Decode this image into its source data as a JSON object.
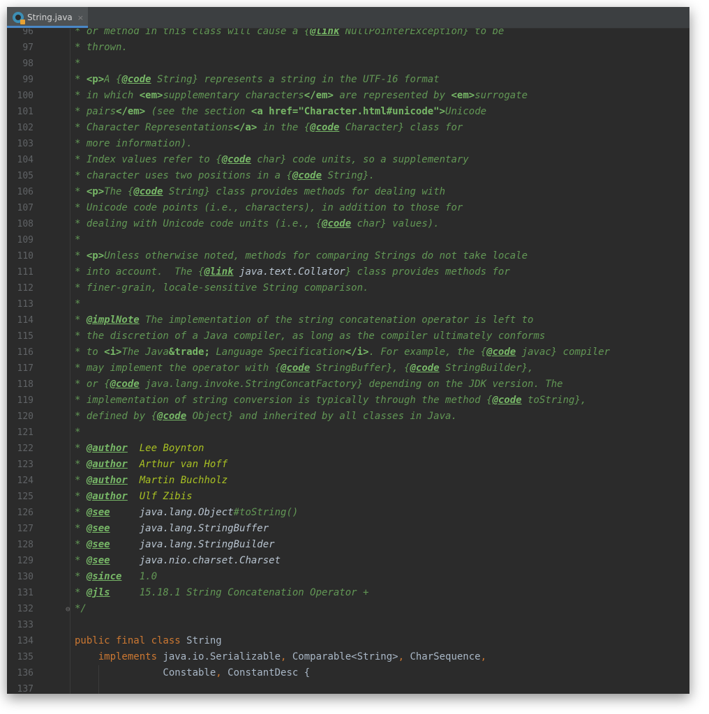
{
  "tab": {
    "label": "String.java",
    "close": "×",
    "icon": "java-class-icon"
  },
  "lines": [
    {
      "n": "96",
      "segs": [
        [
          "c",
          "* or method in this class will cause a {"
        ],
        [
          "tk",
          "@link"
        ],
        [
          "c",
          " NullPointerException} to be"
        ]
      ]
    },
    {
      "n": "97",
      "segs": [
        [
          "c",
          "* thrown."
        ]
      ]
    },
    {
      "n": "98",
      "segs": [
        [
          "c",
          "*"
        ]
      ]
    },
    {
      "n": "99",
      "segs": [
        [
          "c",
          "* "
        ],
        [
          "tg",
          "<p>"
        ],
        [
          "c",
          "A {"
        ],
        [
          "tk",
          "@code"
        ],
        [
          "c",
          " String} represents a string in the UTF-16 format"
        ]
      ]
    },
    {
      "n": "100",
      "segs": [
        [
          "c",
          "* in which "
        ],
        [
          "tg",
          "<em>"
        ],
        [
          "c",
          "supplementary characters"
        ],
        [
          "tg",
          "</em>"
        ],
        [
          "c",
          " are represented by "
        ],
        [
          "tg",
          "<em>"
        ],
        [
          "c",
          "surrogate"
        ]
      ]
    },
    {
      "n": "101",
      "segs": [
        [
          "c",
          "* pairs"
        ],
        [
          "tg",
          "</em>"
        ],
        [
          "c",
          " (see the section "
        ],
        [
          "tg",
          "<a href=\"Character.html#unicode\">"
        ],
        [
          "c",
          "Unicode"
        ]
      ]
    },
    {
      "n": "102",
      "segs": [
        [
          "c",
          "* Character Representations"
        ],
        [
          "tg",
          "</a>"
        ],
        [
          "c",
          " in the {"
        ],
        [
          "tk",
          "@code"
        ],
        [
          "c",
          " Character} class for"
        ]
      ]
    },
    {
      "n": "103",
      "segs": [
        [
          "c",
          "* more information)."
        ]
      ]
    },
    {
      "n": "104",
      "segs": [
        [
          "c",
          "* Index values refer to {"
        ],
        [
          "tk",
          "@code"
        ],
        [
          "c",
          " char} code units, so a supplementary"
        ]
      ]
    },
    {
      "n": "105",
      "segs": [
        [
          "c",
          "* character uses two positions in a {"
        ],
        [
          "tk",
          "@code"
        ],
        [
          "c",
          " String}."
        ]
      ]
    },
    {
      "n": "106",
      "segs": [
        [
          "c",
          "* "
        ],
        [
          "tg",
          "<p>"
        ],
        [
          "c",
          "The {"
        ],
        [
          "tk",
          "@code"
        ],
        [
          "c",
          " String} class provides methods for dealing with"
        ]
      ]
    },
    {
      "n": "107",
      "segs": [
        [
          "c",
          "* Unicode code points (i.e., characters), in addition to those for"
        ]
      ]
    },
    {
      "n": "108",
      "segs": [
        [
          "c",
          "* dealing with Unicode code units (i.e., {"
        ],
        [
          "tk",
          "@code"
        ],
        [
          "c",
          " char} values)."
        ]
      ]
    },
    {
      "n": "109",
      "segs": [
        [
          "c",
          "*"
        ]
      ]
    },
    {
      "n": "110",
      "segs": [
        [
          "c",
          "* "
        ],
        [
          "tg",
          "<p>"
        ],
        [
          "c",
          "Unless otherwise noted, methods for comparing Strings do not take locale"
        ]
      ]
    },
    {
      "n": "111",
      "segs": [
        [
          "c",
          "* into account.  The {"
        ],
        [
          "tk",
          "@link"
        ],
        [
          "lr",
          " java.text.Collator"
        ],
        [
          "c",
          "} class provides methods for"
        ]
      ]
    },
    {
      "n": "112",
      "segs": [
        [
          "c",
          "* finer-grain, locale-sensitive String comparison."
        ]
      ]
    },
    {
      "n": "113",
      "segs": [
        [
          "c",
          "*"
        ]
      ]
    },
    {
      "n": "114",
      "segs": [
        [
          "c",
          "* "
        ],
        [
          "tk",
          "@implNote"
        ],
        [
          "c",
          " The implementation of the string concatenation operator is left to"
        ]
      ]
    },
    {
      "n": "115",
      "segs": [
        [
          "c",
          "* the discretion of a Java compiler, as long as the compiler ultimately conforms"
        ]
      ]
    },
    {
      "n": "116",
      "segs": [
        [
          "c",
          "* to "
        ],
        [
          "tg",
          "<i>"
        ],
        [
          "c",
          "The Java"
        ],
        [
          "tg",
          "&trade;"
        ],
        [
          "c",
          " Language Specification"
        ],
        [
          "tg",
          "</i>"
        ],
        [
          "c",
          ". For example, the {"
        ],
        [
          "tk",
          "@code"
        ],
        [
          "c",
          " javac} compiler"
        ]
      ]
    },
    {
      "n": "117",
      "segs": [
        [
          "c",
          "* may implement the operator with {"
        ],
        [
          "tk",
          "@code"
        ],
        [
          "c",
          " StringBuffer}, {"
        ],
        [
          "tk",
          "@code"
        ],
        [
          "c",
          " StringBuilder},"
        ]
      ]
    },
    {
      "n": "118",
      "segs": [
        [
          "c",
          "* or {"
        ],
        [
          "tk",
          "@code"
        ],
        [
          "c",
          " java.lang.invoke.StringConcatFactory} depending on the JDK version. The"
        ]
      ]
    },
    {
      "n": "119",
      "segs": [
        [
          "c",
          "* implementation of string conversion is typically through the method {"
        ],
        [
          "tk",
          "@code"
        ],
        [
          "c",
          " toString},"
        ]
      ]
    },
    {
      "n": "120",
      "segs": [
        [
          "c",
          "* defined by {"
        ],
        [
          "tk",
          "@code"
        ],
        [
          "c",
          " Object} and inherited by all classes in Java."
        ]
      ]
    },
    {
      "n": "121",
      "segs": [
        [
          "c",
          "*"
        ]
      ]
    },
    {
      "n": "122",
      "segs": [
        [
          "c",
          "* "
        ],
        [
          "tk",
          "@author"
        ],
        [
          "av",
          "  Lee Boynton"
        ]
      ]
    },
    {
      "n": "123",
      "segs": [
        [
          "c",
          "* "
        ],
        [
          "tk",
          "@author"
        ],
        [
          "av",
          "  Arthur van Hoff"
        ]
      ]
    },
    {
      "n": "124",
      "segs": [
        [
          "c",
          "* "
        ],
        [
          "tk",
          "@author"
        ],
        [
          "av",
          "  Martin Buchholz"
        ]
      ]
    },
    {
      "n": "125",
      "segs": [
        [
          "c",
          "* "
        ],
        [
          "tk",
          "@author"
        ],
        [
          "av",
          "  Ulf Zibis"
        ]
      ]
    },
    {
      "n": "126",
      "segs": [
        [
          "c",
          "* "
        ],
        [
          "tk",
          "@see"
        ],
        [
          "c",
          "     "
        ],
        [
          "lr",
          "java.lang.Object"
        ],
        [
          "c",
          "#toString()"
        ]
      ]
    },
    {
      "n": "127",
      "segs": [
        [
          "c",
          "* "
        ],
        [
          "tk",
          "@see"
        ],
        [
          "c",
          "     "
        ],
        [
          "lr",
          "java.lang.StringBuffer"
        ]
      ]
    },
    {
      "n": "128",
      "segs": [
        [
          "c",
          "* "
        ],
        [
          "tk",
          "@see"
        ],
        [
          "c",
          "     "
        ],
        [
          "lr",
          "java.lang.StringBuilder"
        ]
      ]
    },
    {
      "n": "129",
      "segs": [
        [
          "c",
          "* "
        ],
        [
          "tk",
          "@see"
        ],
        [
          "c",
          "     "
        ],
        [
          "lr",
          "java.nio.charset.Charset"
        ]
      ]
    },
    {
      "n": "130",
      "segs": [
        [
          "c",
          "* "
        ],
        [
          "tk",
          "@since"
        ],
        [
          "c",
          "   1.0"
        ]
      ]
    },
    {
      "n": "131",
      "segs": [
        [
          "c",
          "* "
        ],
        [
          "tk",
          "@jls"
        ],
        [
          "c",
          "     15.18.1 String Concatenation Operator +"
        ]
      ]
    },
    {
      "n": "132",
      "segs": [
        [
          "c",
          "*/"
        ]
      ]
    },
    {
      "n": "133",
      "segs": []
    },
    {
      "n": "134",
      "segs": [
        [
          "kw",
          "public final class "
        ],
        [
          "pl",
          "String"
        ]
      ]
    },
    {
      "n": "135",
      "segs": [
        [
          "kw",
          "    implements "
        ],
        [
          "pl",
          "java.io.Serializable"
        ],
        [
          "kw",
          ", "
        ],
        [
          "pl",
          "Comparable<String>"
        ],
        [
          "kw",
          ", "
        ],
        [
          "pl",
          "CharSequence"
        ],
        [
          "kw",
          ","
        ]
      ]
    },
    {
      "n": "136",
      "segs": [
        [
          "pl",
          "               Constable"
        ],
        [
          "kw",
          ", "
        ],
        [
          "pl",
          "ConstantDesc {"
        ]
      ]
    },
    {
      "n": "137",
      "segs": []
    }
  ]
}
